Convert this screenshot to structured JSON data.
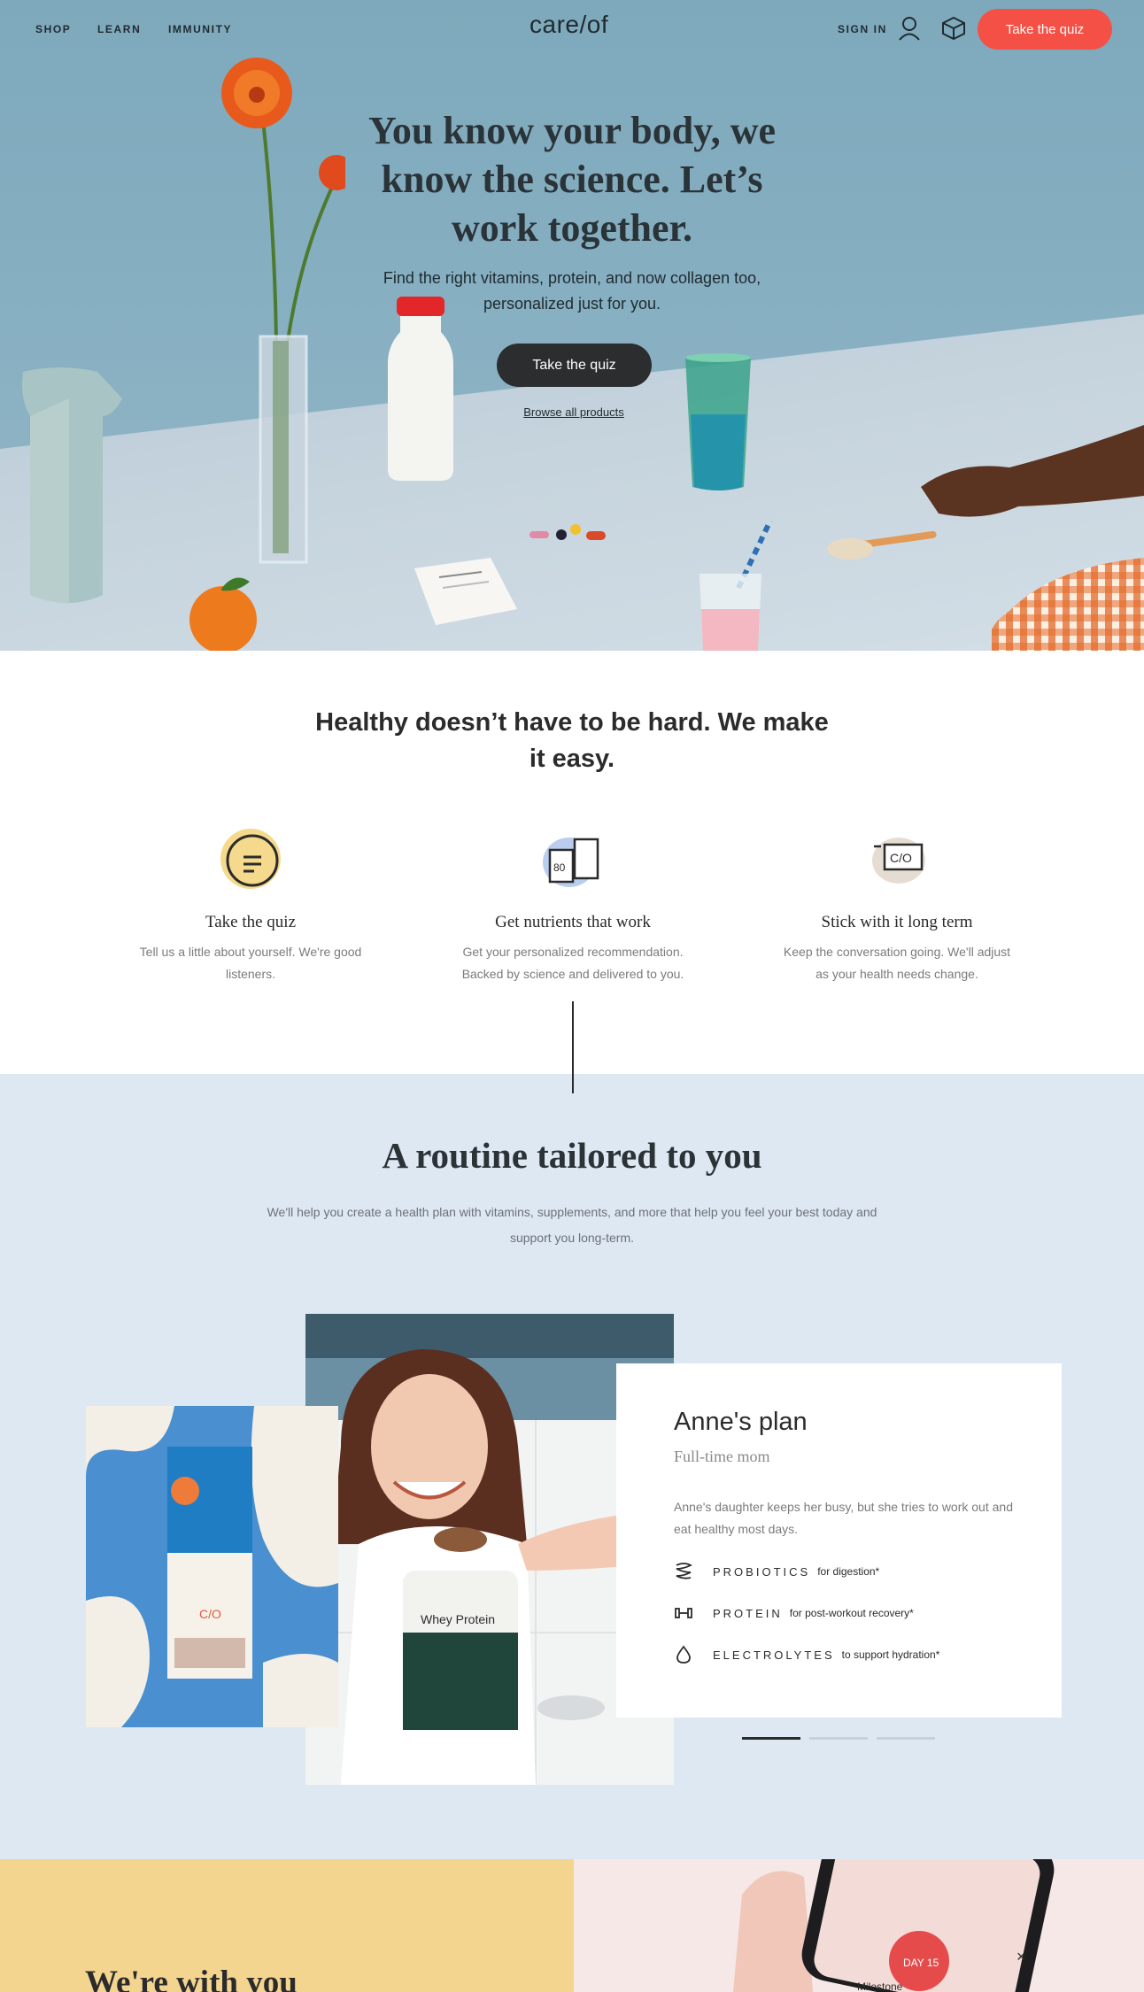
{
  "nav": {
    "links": [
      "SHOP",
      "LEARN",
      "IMMUNITY"
    ],
    "logo": "care/of",
    "sign_in": "SIGN IN",
    "cta": "Take the quiz"
  },
  "hero": {
    "title": "You know your body, we know the science. Let’s work together.",
    "subtitle": "Find the right vitamins, protein, and now collagen too, personalized just for you.",
    "cta": "Take the quiz",
    "link": "Browse all products"
  },
  "how": {
    "title": "Healthy doesn’t have to be hard. We make it easy.",
    "steps": [
      {
        "icon": "quiz-quote-icon",
        "title": "Take the quiz",
        "desc": "Tell us a little about yourself. We're good listeners."
      },
      {
        "icon": "nutrient-packs-icon",
        "title": "Get nutrients that work",
        "desc": "Get your personalized recommendation. Backed by science and delivered to you."
      },
      {
        "icon": "careof-box-icon",
        "title": "Stick with it long term",
        "desc": "Keep the conversation going. We'll adjust as your health needs change."
      }
    ]
  },
  "routine": {
    "title": "A routine tailored to you",
    "subtitle": "We'll help you create a health plan with vitamins, supplements, and more that help you feel your best today and support you long-term.",
    "product_label": "Whey Protein",
    "pack_label": "C/O",
    "card": {
      "name": "Anne's plan",
      "role": "Full-time mom",
      "desc": "Anne's daughter keeps her busy, but she tries to work out and eat healthy most days.",
      "benefits": [
        {
          "icon": "gut-icon",
          "name": "PROBIOTICS",
          "note": "for digestion*"
        },
        {
          "icon": "dumbbell-icon",
          "name": "PROTEIN",
          "note": "for post-workout recovery*"
        },
        {
          "icon": "droplet-icon",
          "name": "ELECTROLYTES",
          "note": "to support hydration*"
        }
      ],
      "carousel_active": 1,
      "carousel_total": 3
    }
  },
  "bottom": {
    "title": "We're with you",
    "phone_badge": "DAY 15",
    "phone_caption": "Milestone"
  },
  "colors": {
    "accent": "#f55045",
    "dark_button": "#2b2d2f",
    "routine_bg": "#dde8f3",
    "yellow": "#f3d590"
  }
}
